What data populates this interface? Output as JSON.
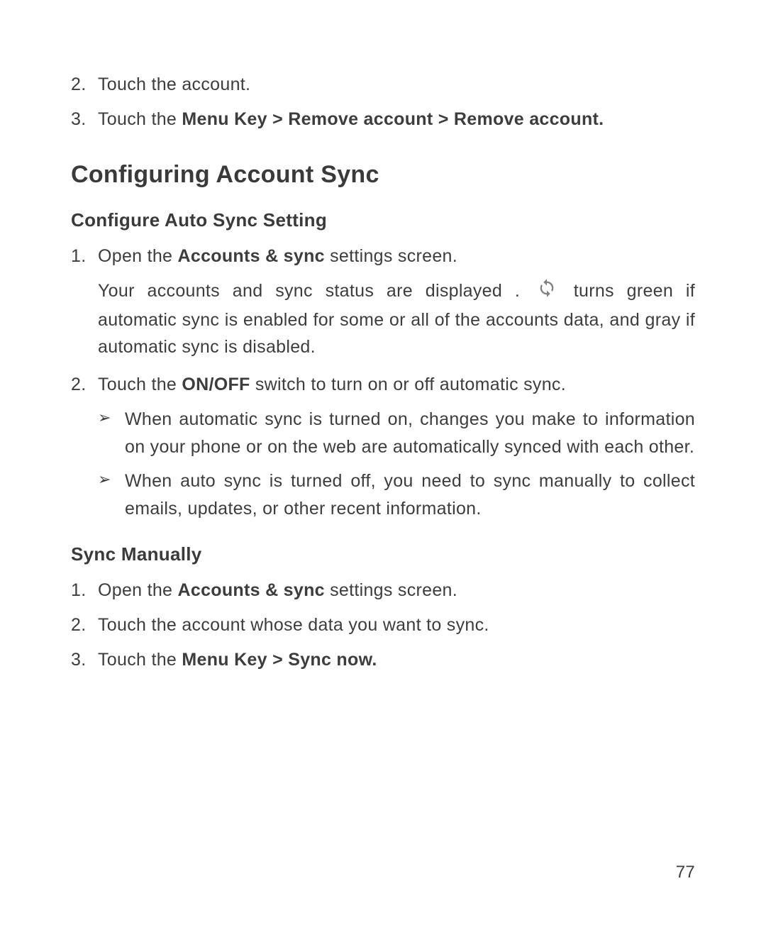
{
  "prelist": {
    "item2": {
      "num": "2.",
      "text": "Touch the account."
    },
    "item3": {
      "num": "3.",
      "prefix": "Touch the ",
      "bold": "Menu Key > Remove account > Remove account."
    }
  },
  "heading1": "Configuring Account Sync",
  "sub1": "Configure Auto Sync Setting",
  "list1": {
    "item1": {
      "num": "1.",
      "prefix": "Open the ",
      "bold": "Accounts & sync",
      "suffix": " settings screen."
    },
    "item1_extra_before": "Your accounts and sync status are displayed . ",
    "item1_extra_after": " turns green if automatic sync is enabled for some or all of the accounts data, and gray if automatic sync is disabled.",
    "item2": {
      "num": "2.",
      "prefix": "Touch the ",
      "bold": "ON/OFF",
      "suffix": " switch to turn on or off automatic sync."
    },
    "bullet1": "When automatic sync is turned on, changes you make to information on your phone or on the web are automatically synced with each other.",
    "bullet2": "When auto sync is turned off, you need to sync manually to collect emails, updates, or other recent information."
  },
  "sub2": "Sync Manually",
  "list2": {
    "item1": {
      "num": "1.",
      "prefix": "Open the ",
      "bold": "Accounts & sync",
      "suffix": " settings screen."
    },
    "item2": {
      "num": "2.",
      "text": "Touch the account whose data you want to sync."
    },
    "item3": {
      "num": "3.",
      "prefix": "Touch the ",
      "bold": "Menu Key > Sync now."
    }
  },
  "page_number": "77",
  "bullet_symbol": "➢"
}
